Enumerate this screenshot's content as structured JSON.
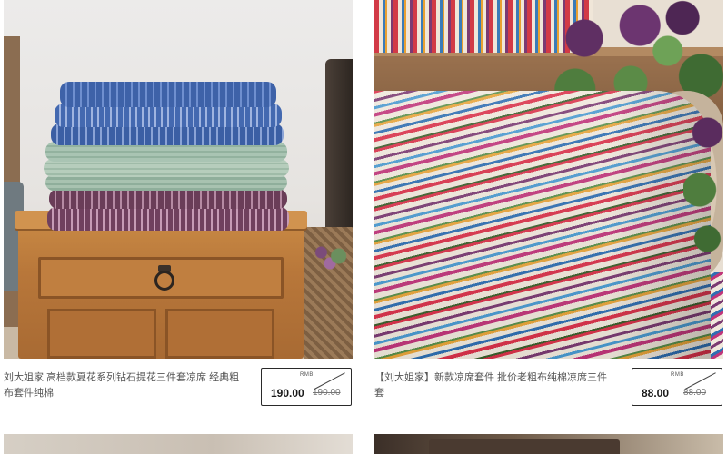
{
  "products": [
    {
      "image_alt": "Stacked blue, green and purple woven cotton mats on a wooden nightstand",
      "title": "刘大姐家 高档款夏花系列钻石提花三件套凉席 经典粗布套件纯棉",
      "currency": "RMB",
      "sale_price": "190.00",
      "original_price": "190.00"
    },
    {
      "image_alt": "Rolled multicolor striped cotton mat with purple flowers",
      "title": "【刘大姐家】新款凉席套件 批价老粗布纯棉凉席三件套",
      "currency": "RMB",
      "sale_price": "88.00",
      "original_price": "88.00"
    }
  ],
  "colors": {
    "text": "#555555",
    "price": "#1a1a1a",
    "price_border": "#2a2a2a"
  }
}
